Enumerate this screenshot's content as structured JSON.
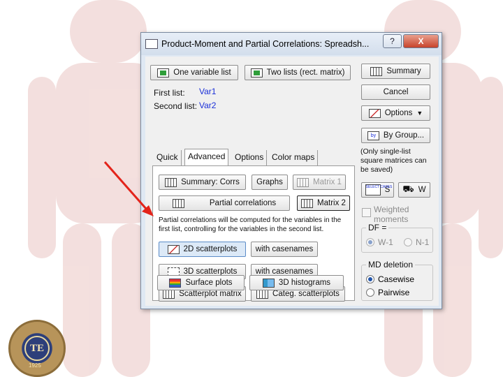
{
  "window": {
    "title": "Product-Moment and Partial Correlations: Spreadsh...",
    "help_label": "?",
    "close_label": "X"
  },
  "buttons": {
    "one_variable_list": "One variable list",
    "two_lists": "Two lists (rect. matrix)",
    "summary": "Summary",
    "cancel": "Cancel",
    "options": "Options",
    "by_group": "By Group...",
    "summary_corrs": "Summary:  Corrs",
    "graphs": "Graphs",
    "matrix1": "Matrix 1",
    "partial_correlations": "Partial correlations",
    "matrix2": "Matrix 2",
    "scatter2d": "2D scatterplots",
    "with_casenames_1": "with casenames",
    "scatter3d": "3D scatterplots",
    "with_casenames_2": "with casenames",
    "scatterplot_matrix": "Scatterplot matrix",
    "categ_scatterplots": "Categ. scatterplots",
    "surface_plots": "Surface plots",
    "histograms3d": "3D histograms",
    "select_cases_label": "S",
    "weight_label": "W",
    "select_cases_icon_text": "SELECT CASES",
    "by_icon_text": "by"
  },
  "lists": {
    "first_label": "First list:",
    "first_value": "Var1",
    "second_label": "Second list:",
    "second_value": "Var2"
  },
  "tabs": [
    "Quick",
    "Advanced",
    "Options",
    "Color maps"
  ],
  "notes": {
    "single_list": "(Only single-list square matrices can be saved)",
    "partial_info": "Partial correlations will be computed for the variables in the first list, controlling for the variables in the second list."
  },
  "weighted_moments": "Weighted moments",
  "df": {
    "title": "DF =",
    "options": [
      "W-1",
      "N-1"
    ],
    "selected": "W-1"
  },
  "md_deletion": {
    "title": "MD deletion",
    "options": [
      "Casewise",
      "Pairwise"
    ],
    "selected": "Casewise"
  },
  "logo": {
    "text": "TE",
    "year": "1925"
  },
  "colors": {
    "arrow": "#e3241b",
    "title_bar": "#dfe8f3",
    "link_blue": "#1a2fd8"
  }
}
